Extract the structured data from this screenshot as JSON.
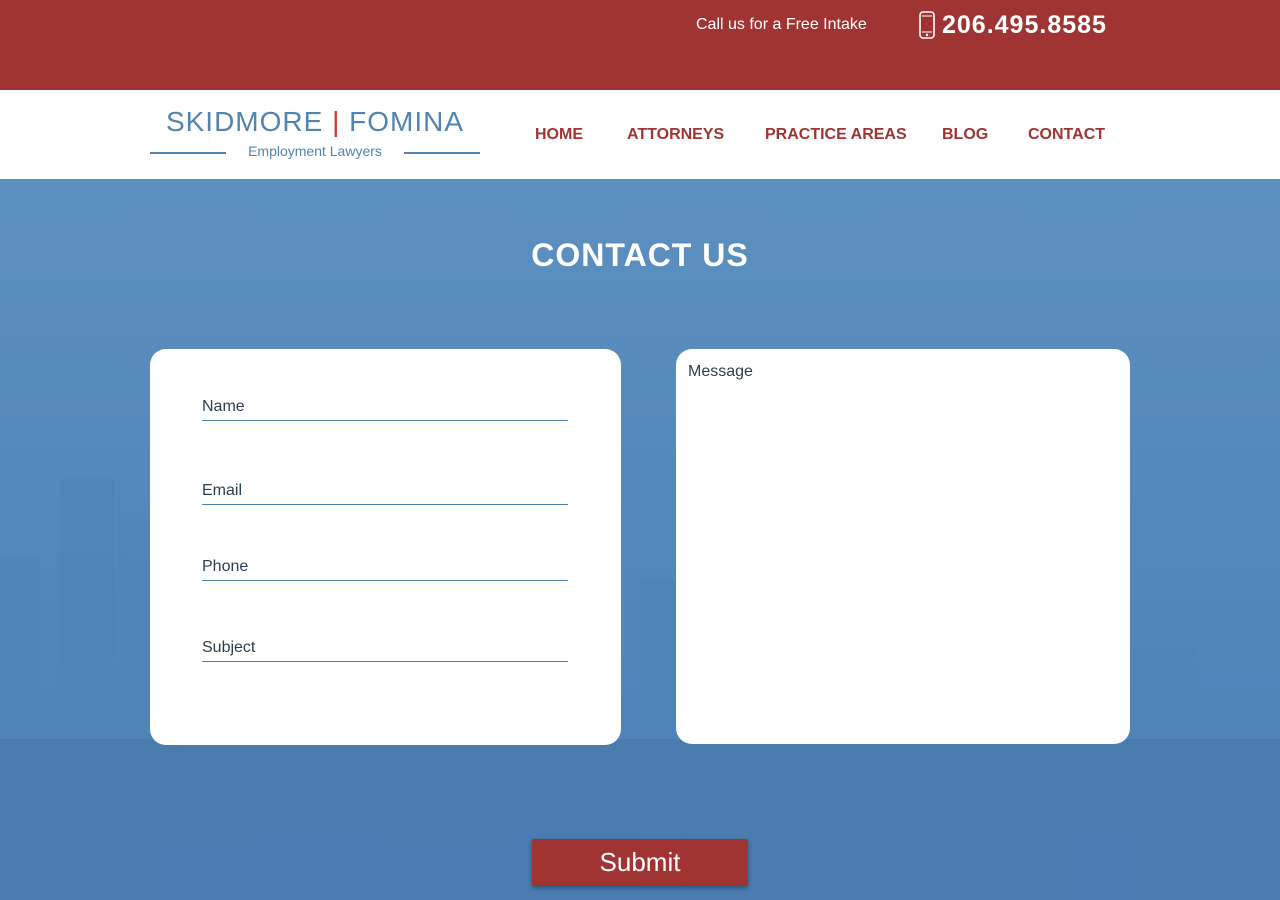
{
  "topbar": {
    "cta_text": "Call us for a Free Intake",
    "phone_number": "206.495.8585",
    "phone_icon": "mobile-phone-icon",
    "background_color": "#a03432"
  },
  "logo": {
    "name_left": "SKIDMORE",
    "separator": "|",
    "name_right": "FOMINA",
    "tagline": "Employment Lawyers",
    "brand_color": "#5184b3",
    "separator_color": "#d2352f"
  },
  "nav": {
    "items": [
      {
        "label": "HOME"
      },
      {
        "label": "ATTORNEYS"
      },
      {
        "label": "PRACTICE AREAS"
      },
      {
        "label": "BLOG"
      },
      {
        "label": "CONTACT"
      }
    ],
    "color": "#a03432"
  },
  "contact": {
    "heading": "CONTACT US",
    "fields": {
      "name_placeholder": "Name",
      "email_placeholder": "Email",
      "phone_placeholder": "Phone",
      "subject_placeholder": "Subject",
      "message_placeholder": "Message"
    },
    "submit_label": "Submit",
    "background_color": "#5a8fbe"
  }
}
